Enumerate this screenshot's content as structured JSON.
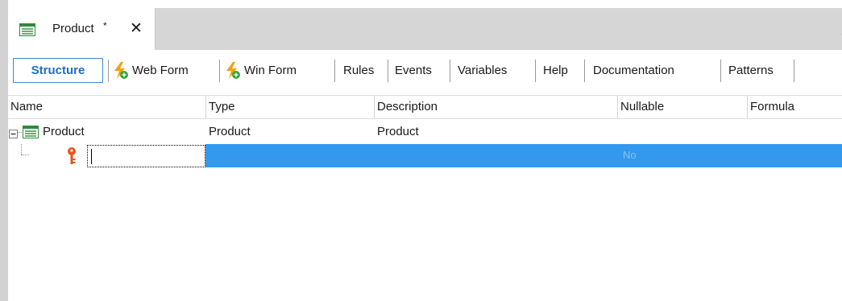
{
  "document_tab": {
    "title": "Product",
    "dirty_marker": "*",
    "close_glyph": "✕",
    "icon": "transaction-icon"
  },
  "toolbar": {
    "structure": "Structure",
    "web_form": "Web Form",
    "win_form": "Win Form",
    "rules": "Rules",
    "events": "Events",
    "variables": "Variables",
    "help": "Help",
    "documentation": "Documentation",
    "patterns": "Patterns",
    "form_icon": "lightning-plus-icon"
  },
  "columns": {
    "name": "Name",
    "type": "Type",
    "description": "Description",
    "nullable": "Nullable",
    "formula": "Formula"
  },
  "rows": [
    {
      "name": "Product",
      "type": "Product",
      "description": "Product",
      "nullable": "",
      "formula": "",
      "icon": "transaction-icon",
      "expander": "minus-expander-icon"
    },
    {
      "name": "",
      "type": "",
      "description": "",
      "nullable": "No",
      "formula": "",
      "icon": "key-icon",
      "selected": true,
      "editing": true
    }
  ],
  "colors": {
    "selection": "#3399ee",
    "active_tab_text": "#1e6fc2",
    "transaction_icon": "#2e8b3a",
    "key_icon": "#e8541e",
    "bolt_icon": "#f2a20c",
    "plus_badge": "#3aa63a"
  }
}
